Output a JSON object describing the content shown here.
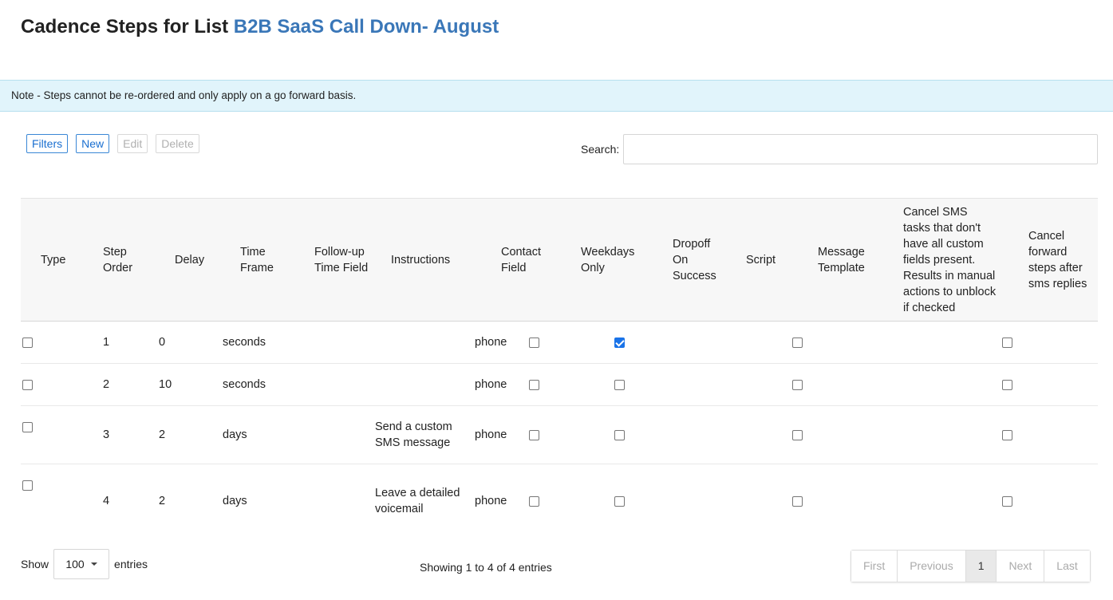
{
  "header": {
    "title_prefix": "Cadence Steps for List",
    "list_name": "B2B SaaS Call Down- August"
  },
  "note": "Note - Steps cannot be re-ordered and only apply on a go forward basis.",
  "toolbar": {
    "filters": "Filters",
    "new": "New",
    "edit": "Edit",
    "delete": "Delete"
  },
  "search": {
    "label": "Search:",
    "value": "",
    "placeholder": ""
  },
  "table": {
    "columns": [
      "Type",
      "Step Order",
      "Delay",
      "Time Frame",
      "Follow-up Time Field",
      "Instructions",
      "Contact Field",
      "Weekdays Only",
      "Dropoff On Success",
      "Script",
      "Message Template",
      "Cancel SMS tasks that don't have all custom fields present. Results in manual actions to unblock if checked",
      "Cancel forward steps after sms replies"
    ],
    "rows": [
      {
        "step": "1",
        "delay": "0",
        "timeframe": "seconds",
        "followup": "",
        "instructions": "",
        "contact": "phone",
        "weekdays": false,
        "dropoff": true,
        "script": "",
        "template": "",
        "cancel_sms": false,
        "cancel_forward": false
      },
      {
        "step": "2",
        "delay": "10",
        "timeframe": "seconds",
        "followup": "",
        "instructions": "",
        "contact": "phone",
        "weekdays": false,
        "dropoff": false,
        "script": "",
        "template": "",
        "cancel_sms": false,
        "cancel_forward": false
      },
      {
        "step": "3",
        "delay": "2",
        "timeframe": "days",
        "followup": "",
        "instructions": "Send a custom SMS message",
        "contact": "phone",
        "weekdays": false,
        "dropoff": false,
        "script": "",
        "template": "",
        "cancel_sms": false,
        "cancel_forward": false
      },
      {
        "step": "4",
        "delay": "2",
        "timeframe": "days",
        "followup": "",
        "instructions": "Leave a detailed voicemail",
        "contact": "phone",
        "weekdays": false,
        "dropoff": false,
        "script": "",
        "template": "",
        "cancel_sms": false,
        "cancel_forward": false
      }
    ]
  },
  "footer": {
    "show_label": "Show",
    "entries_label": "entries",
    "page_length": "100",
    "info": "Showing 1 to 4 of 4 entries",
    "pagination": [
      "First",
      "Previous",
      "1",
      "Next",
      "Last"
    ],
    "current_page": "1"
  }
}
